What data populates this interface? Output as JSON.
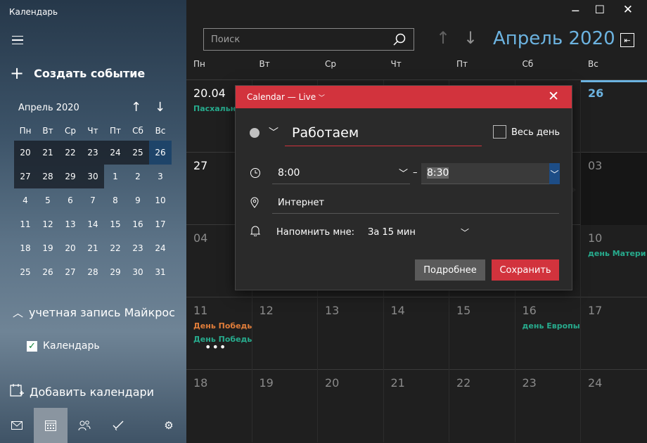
{
  "window": {
    "app_title": "Календарь",
    "minimize": "─",
    "maximize": "☐",
    "close": "✕"
  },
  "sidebar": {
    "new_event_label": "Создать событие",
    "mini_calendar": {
      "title": "Апрель 2020",
      "days_of_week": [
        "Пн",
        "Вт",
        "Ср",
        "Чт",
        "Пт",
        "Сб",
        "Вс"
      ],
      "weeks": [
        [
          "20",
          "21",
          "22",
          "23",
          "24",
          "25",
          "26"
        ],
        [
          "27",
          "28",
          "29",
          "30",
          "1",
          "2",
          "3"
        ],
        [
          "4",
          "5",
          "6",
          "7",
          "8",
          "9",
          "10"
        ],
        [
          "11",
          "12",
          "13",
          "14",
          "15",
          "16",
          "17"
        ],
        [
          "18",
          "19",
          "20",
          "21",
          "22",
          "23",
          "24"
        ],
        [
          "25",
          "26",
          "27",
          "28",
          "29",
          "30",
          "31"
        ]
      ],
      "today": "26"
    },
    "account_label": "учетная запись Майкрософт",
    "calendar_item_label": "Календарь",
    "calendar_item_checked": true,
    "add_calendars_label": "Добавить календари"
  },
  "toolbar": {
    "search_placeholder": "Поиск",
    "month_title": "Апрель 2020"
  },
  "calendar": {
    "days_of_week": [
      "Пн",
      "Вт",
      "Ср",
      "Чт",
      "Пт",
      "Сб",
      "Вс"
    ],
    "weeks": [
      [
        {
          "num": "20.04",
          "events": [
            {
              "text": "Пасхальное воскресенье",
              "color": "green"
            }
          ]
        },
        {
          "num": "",
          "events": []
        },
        {
          "num": "",
          "events": []
        },
        {
          "num": "",
          "events": []
        },
        {
          "num": "",
          "events": []
        },
        {
          "num": "",
          "events": []
        },
        {
          "num": "26",
          "events": [],
          "today": true
        }
      ],
      [
        {
          "num": "27",
          "events": []
        },
        {
          "num": "",
          "events": []
        },
        {
          "num": "",
          "events": []
        },
        {
          "num": "",
          "events": []
        },
        {
          "num": "",
          "events": []
        },
        {
          "num": "",
          "events": []
        },
        {
          "num": "03",
          "events": [],
          "dim": true
        }
      ],
      [
        {
          "num": "04",
          "events": [],
          "dim": true
        },
        {
          "num": "",
          "events": []
        },
        {
          "num": "",
          "events": []
        },
        {
          "num": "",
          "events": []
        },
        {
          "num": "",
          "events": []
        },
        {
          "num": "",
          "events": []
        },
        {
          "num": "10",
          "events": [
            {
              "text": "день Матери",
              "color": "green"
            }
          ],
          "dim": true
        }
      ],
      [
        {
          "num": "11",
          "events": [
            {
              "text": "День Победы",
              "color": "orange"
            },
            {
              "text": "День Победы",
              "color": "green"
            }
          ],
          "more": "•••",
          "dim": true
        },
        {
          "num": "12",
          "events": [],
          "dim": true
        },
        {
          "num": "13",
          "events": [],
          "dim": true
        },
        {
          "num": "14",
          "events": [],
          "dim": true
        },
        {
          "num": "15",
          "events": [],
          "dim": true
        },
        {
          "num": "16",
          "events": [
            {
              "text": "день Европы",
              "color": "green"
            }
          ],
          "dim": true
        },
        {
          "num": "17",
          "events": [],
          "dim": true
        }
      ],
      [
        {
          "num": "18",
          "events": [],
          "dim": true
        },
        {
          "num": "19",
          "events": [],
          "dim": true
        },
        {
          "num": "20",
          "events": [],
          "dim": true
        },
        {
          "num": "21",
          "events": [],
          "dim": true
        },
        {
          "num": "22",
          "events": [],
          "dim": true
        },
        {
          "num": "23",
          "events": [],
          "dim": true
        },
        {
          "num": "24",
          "events": [],
          "dim": true
        }
      ]
    ]
  },
  "popup": {
    "calendar_name": "Calendar — Live",
    "title_value": "Работаем",
    "all_day_label": "Весь день",
    "start_time": "8:00",
    "end_time": "8:30",
    "location": "Интернет",
    "remind_label": "Напомнить мне:",
    "remind_value": "За 15 мин",
    "more_button": "Подробнее",
    "save_button": "Сохранить"
  },
  "colors": {
    "accent_red": "#d2333d",
    "accent_blue": "#6cb3e0",
    "event_green": "#27ab8d",
    "event_orange": "#e07d3a"
  },
  "icons": [
    "hamburger-icon",
    "plus-icon",
    "arrow-up-icon",
    "arrow-down-icon",
    "chevron-up-icon",
    "checkbox-icon",
    "add-calendar-icon",
    "mail-icon",
    "calendar-icon",
    "people-icon",
    "todo-icon",
    "settings-icon",
    "search-icon",
    "today-icon",
    "close-icon",
    "circle-icon",
    "chevron-down-icon",
    "clock-icon",
    "location-icon",
    "bell-icon"
  ]
}
